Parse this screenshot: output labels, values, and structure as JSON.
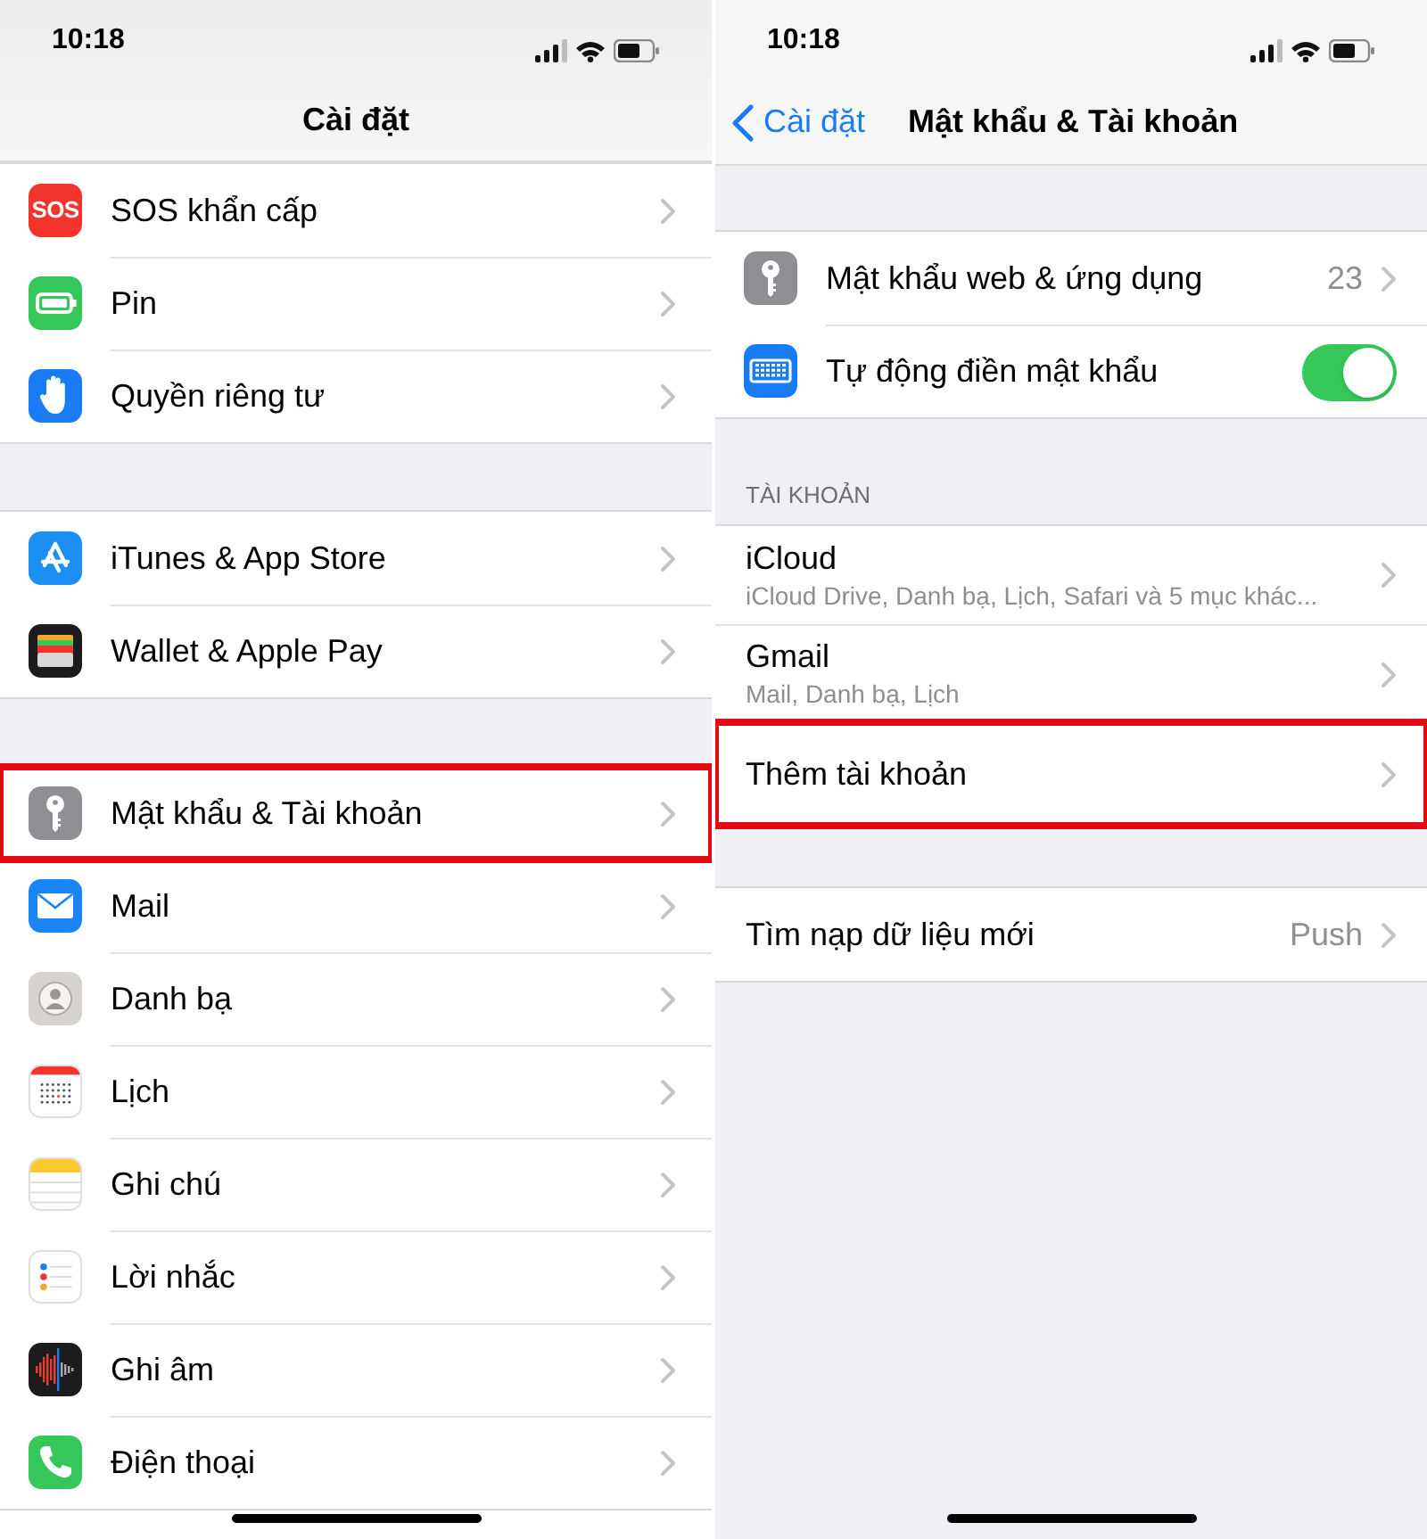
{
  "left": {
    "status": {
      "time": "10:18"
    },
    "title": "Cài đặt",
    "groups": [
      [
        {
          "kind": "sos",
          "badge": "SOS",
          "label": "SOS khẩn cấp",
          "highlighted": false
        },
        {
          "kind": "battery",
          "label": "Pin",
          "highlighted": false
        },
        {
          "kind": "hand",
          "label": "Quyền riêng tư",
          "highlighted": false
        }
      ],
      [
        {
          "kind": "appstore",
          "label": "iTunes & App Store",
          "highlighted": false
        },
        {
          "kind": "wallet",
          "label": "Wallet & Apple Pay",
          "highlighted": false
        }
      ],
      [
        {
          "kind": "key",
          "label": "Mật khẩu & Tài khoản",
          "highlighted": true
        },
        {
          "kind": "mail",
          "label": "Mail",
          "highlighted": false
        },
        {
          "kind": "contacts",
          "label": "Danh bạ",
          "highlighted": false
        },
        {
          "kind": "calendar",
          "label": "Lịch",
          "highlighted": false
        },
        {
          "kind": "notes",
          "label": "Ghi chú",
          "highlighted": false
        },
        {
          "kind": "reminders",
          "label": "Lời nhắc",
          "highlighted": false
        },
        {
          "kind": "voice",
          "label": "Ghi âm",
          "highlighted": false
        },
        {
          "kind": "phone",
          "label": "Điện thoại",
          "highlighted": false
        }
      ]
    ]
  },
  "right": {
    "status": {
      "time": "10:18"
    },
    "back": "Cài đặt",
    "title": "Mật khẩu & Tài khoản",
    "groups": [
      {
        "rows": [
          {
            "kind": "nav",
            "label": "Mật khẩu web & ứng dụng",
            "value": "23",
            "highlighted": false
          },
          {
            "kind": "toggle",
            "label": "Tự động điền mật khẩu",
            "on": true,
            "highlighted": false
          }
        ]
      },
      {
        "header": "TÀI KHOẢN",
        "rows": [
          {
            "kind": "account",
            "label": "iCloud",
            "subtitle": "iCloud Drive, Danh bạ, Lịch, Safari và 5 mục khác...",
            "highlighted": false
          },
          {
            "kind": "account",
            "label": "Gmail",
            "subtitle": "Mail, Danh bạ, Lịch",
            "highlighted": false
          },
          {
            "kind": "nav",
            "label": "Thêm tài khoản",
            "highlighted": true
          }
        ]
      },
      {
        "rows": [
          {
            "kind": "nav",
            "label": "Tìm nạp dữ liệu mới",
            "value": "Push",
            "highlighted": false
          }
        ]
      }
    ]
  }
}
